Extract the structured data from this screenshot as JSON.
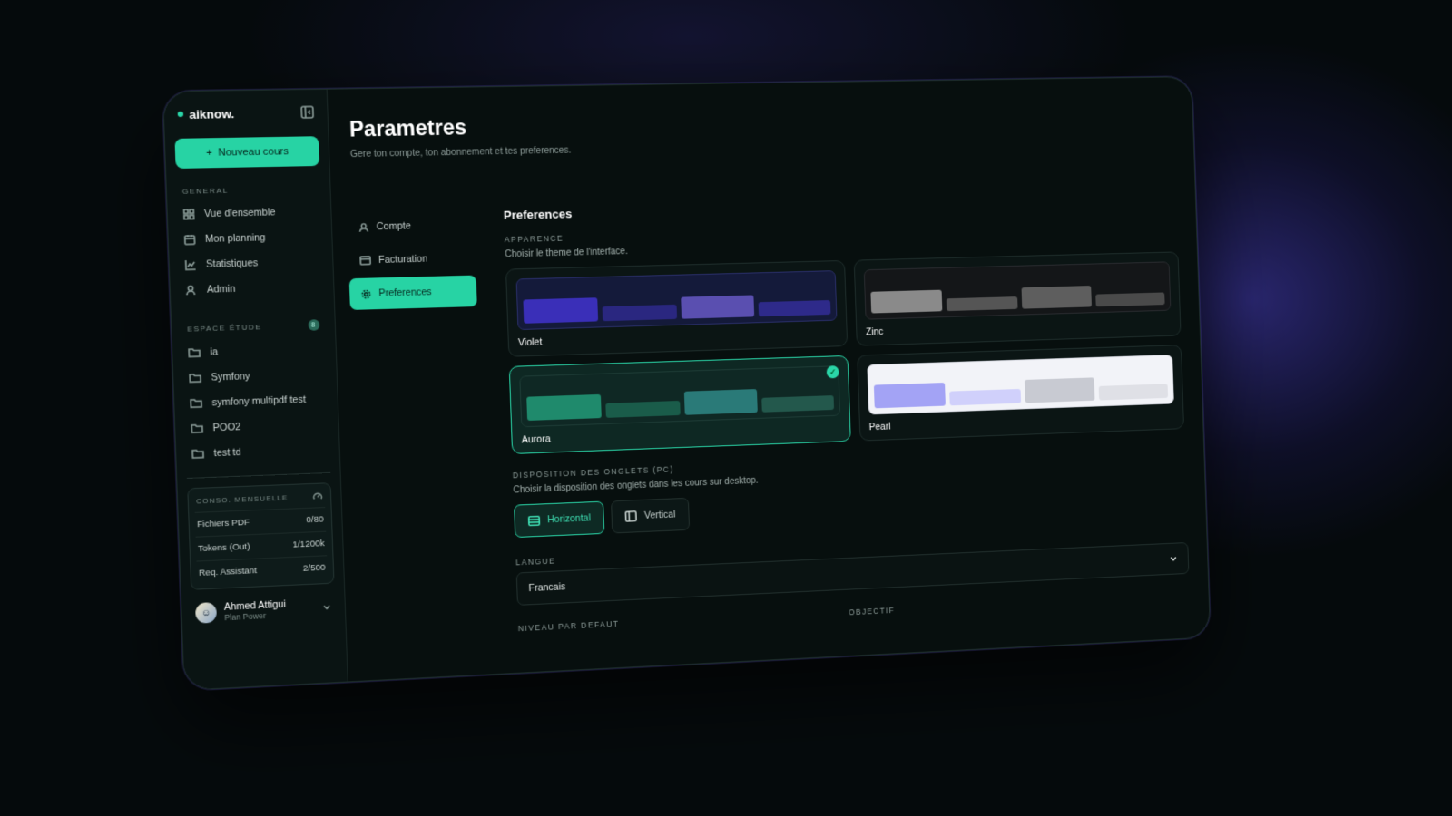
{
  "sidebar": {
    "brand": "aiknow.",
    "new_course": "Nouveau cours",
    "general_title": "GENERAL",
    "general_items": [
      {
        "label": "Vue d'ensemble",
        "icon": "grid-icon"
      },
      {
        "label": "Mon planning",
        "icon": "calendar-icon"
      },
      {
        "label": "Statistiques",
        "icon": "chart-icon"
      },
      {
        "label": "Admin",
        "icon": "user-admin-icon"
      }
    ],
    "study_title": "ESPACE ÉTUDE",
    "study_count": "8",
    "folders": [
      "ia",
      "Symfony",
      "symfony multipdf test",
      "POO2",
      "test td"
    ],
    "usage": {
      "title": "CONSO. MENSUELLE",
      "rows": [
        {
          "label": "Fichiers PDF",
          "value": "0/80"
        },
        {
          "label": "Tokens (Out)",
          "value": "1/1200k"
        },
        {
          "label": "Req. Assistant",
          "value": "2/500"
        }
      ]
    },
    "user": {
      "name": "Ahmed Attigui",
      "plan": "Plan Power"
    }
  },
  "header": {
    "title": "Parametres",
    "subtitle": "Gere ton compte, ton abonnement et tes preferences."
  },
  "tabs": [
    {
      "label": "Compte",
      "icon": "user-icon",
      "active": false
    },
    {
      "label": "Facturation",
      "icon": "credit-card-icon",
      "active": false
    },
    {
      "label": "Preferences",
      "icon": "gear-icon",
      "active": true
    }
  ],
  "preferences": {
    "heading": "Preferences",
    "appearance_label": "APPARENCE",
    "appearance_help": "Choisir le theme de l'interface.",
    "themes": [
      {
        "name": "Violet",
        "selected": false,
        "bg": "#141a3a",
        "bars": [
          "#3a2fb8",
          "#2a2780",
          "#5a4fb0",
          "#2e2a8a"
        ]
      },
      {
        "name": "Zinc",
        "selected": false,
        "bg": "#141618",
        "bars": [
          "#8a8a8a",
          "#555555",
          "#5e5e5e",
          "#4a4a4a"
        ]
      },
      {
        "name": "Aurora",
        "selected": true,
        "bg": "#0f2824",
        "bars": [
          "#1f8a6c",
          "#1a5c4a",
          "#2a7a78",
          "#23584c"
        ]
      },
      {
        "name": "Pearl",
        "selected": false,
        "bg": "#f2f3f8",
        "bars": [
          "#a3a3f5",
          "#d0d0fb",
          "#c8cad2",
          "#dfe0e6"
        ]
      }
    ],
    "tabs_layout_label": "DISPOSITION DES ONGLETS (PC)",
    "tabs_layout_help": "Choisir la disposition des onglets dans les cours sur desktop.",
    "layout_options": [
      {
        "label": "Horizontal",
        "active": true
      },
      {
        "label": "Vertical",
        "active": false
      }
    ],
    "language_label": "LANGUE",
    "language_value": "Francais",
    "level_label": "NIVEAU PAR DEFAUT",
    "objective_label": "OBJECTIF"
  }
}
